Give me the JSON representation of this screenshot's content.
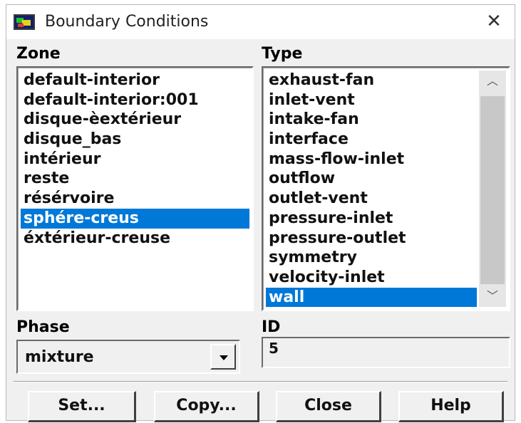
{
  "window": {
    "title": "Boundary Conditions"
  },
  "zone": {
    "label": "Zone",
    "items": [
      "default-interior",
      "default-interior:001",
      "disque-èextérieur",
      "disque_bas",
      "intérieur",
      "reste",
      "résérvoire",
      "sphére-creus",
      "éxtérieur-creuse"
    ],
    "selected_index": 7
  },
  "type": {
    "label": "Type",
    "items": [
      "exhaust-fan",
      "inlet-vent",
      "intake-fan",
      "interface",
      "mass-flow-inlet",
      "outflow",
      "outlet-vent",
      "pressure-inlet",
      "pressure-outlet",
      "symmetry",
      "velocity-inlet",
      "wall"
    ],
    "selected_index": 11
  },
  "phase": {
    "label": "Phase",
    "value": "mixture"
  },
  "id": {
    "label": "ID",
    "value": "5"
  },
  "buttons": {
    "set": "Set...",
    "copy": "Copy...",
    "close": "Close",
    "help": "Help"
  },
  "colors": {
    "selection": "#0078d7",
    "dialog_bg": "#f0f0f0"
  },
  "icons": {
    "app": "fluent-app-icon",
    "close": "close-icon",
    "scroll_up": "chevron-up-icon",
    "scroll_down": "chevron-down-icon",
    "dropdown": "dropdown-arrow-icon"
  }
}
